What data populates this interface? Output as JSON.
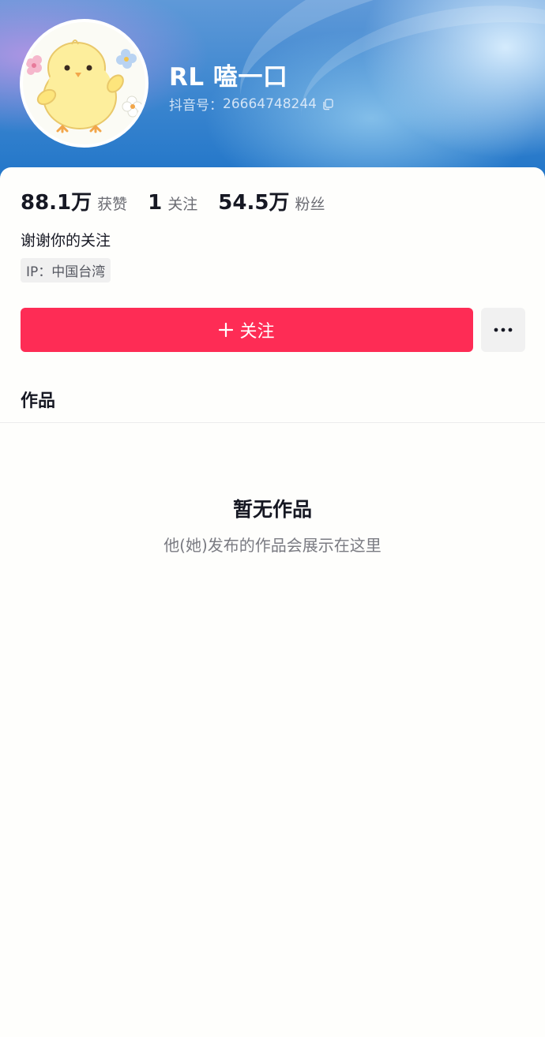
{
  "profile": {
    "nickname": "RL 嗑一口",
    "douyin_id_label": "抖音号：",
    "douyin_id": "26664748244",
    "bio": "谢谢你的关注",
    "ip_location": "IP：中国台湾"
  },
  "stats": [
    {
      "value": "88.1万",
      "label": "获赞"
    },
    {
      "value": "1",
      "label": "关注"
    },
    {
      "value": "54.5万",
      "label": "粉丝"
    }
  ],
  "actions": {
    "follow_label": "关注",
    "more_icon": "more-dots-icon"
  },
  "tabs": {
    "works_label": "作品"
  },
  "empty_state": {
    "title": "暂无作品",
    "subtitle": "他(她)发布的作品会展示在这里"
  },
  "colors": {
    "accent": "#fe2c55",
    "header_blue": "#1f74c8",
    "text_primary": "#161823",
    "text_secondary": "#6b6c73"
  }
}
